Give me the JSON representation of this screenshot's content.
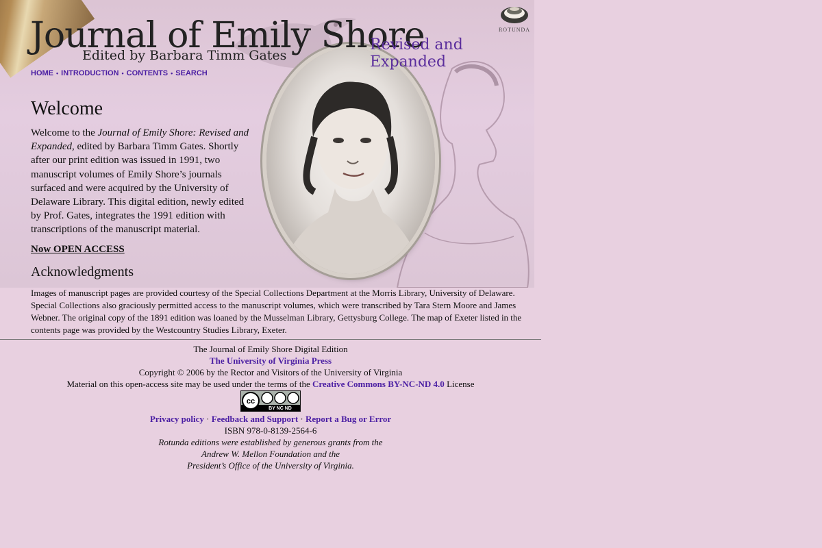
{
  "header": {
    "title": "Journal of Emily Shore",
    "subtitle": "Edited by Barbara Timm Gates",
    "edition_label": "Revised and Expanded",
    "logo_text": "ROTUNDA"
  },
  "nav": {
    "items": [
      {
        "label": "HOME"
      },
      {
        "label": "INTRODUCTION"
      },
      {
        "label": "CONTENTS"
      },
      {
        "label": "SEARCH"
      }
    ]
  },
  "welcome": {
    "heading": "Welcome",
    "intro": "Welcome to the ",
    "book_title": "Journal of Emily Shore: Revised and Expanded",
    "body": ", edited by Barbara Timm Gates. Shortly after our print edition was issued in 1991, two manuscript volumes of Emily Shore’s journals surfaced and were acquired by the University of Delaware Library. This digital edition, newly edited by Prof. Gates, integrates the 1991 edition with transcriptions of the manuscript material.",
    "open_access_label": "Now OPEN ACCESS"
  },
  "acknowledgments": {
    "heading": "Acknowledgments",
    "body": "Images of manuscript pages are provided courtesy of the Special Collections Department at the Morris Library, University of Delaware. Special Collections also graciously permitted access to the manuscript volumes, which were transcribed by Tara Stern Moore and James Webner. The original copy of the 1891 edition was loaned by the Musselman Library, Gettysburg College. The map of Exeter listed in the contents page was provided by the Westcountry Studies Library, Exeter."
  },
  "footer": {
    "edition": "The Journal of Emily Shore Digital Edition",
    "press_link": "The University of Virginia Press",
    "copyright": "Copyright © 2006 by the Rector and Visitors of the University of Virginia",
    "license_prefix": "Material on this open-access site may be used under the terms of the ",
    "license_link": "Creative Commons BY-NC-ND 4.0",
    "license_suffix": " License",
    "cc_badge_text": "BY NC ND",
    "links": [
      {
        "label": "Privacy policy"
      },
      {
        "label": "Feedback and Support"
      },
      {
        "label": "Report a Bug or Error"
      }
    ],
    "isbn": "ISBN 978-0-8139-2564-6",
    "grant_line1": "Rotunda editions were established by generous grants from the",
    "grant_line2": "Andrew W. Mellon Foundation and the",
    "grant_line3": "President’s Office of the University of Virginia."
  }
}
